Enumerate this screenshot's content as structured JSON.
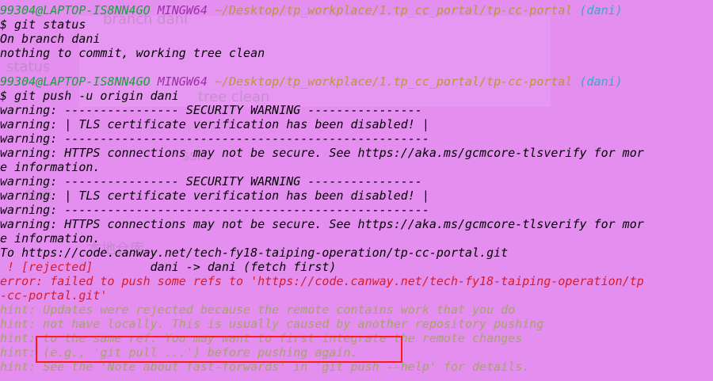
{
  "colors": {
    "background": "#e48ff0",
    "user_host": "#1b9e3b",
    "mingw": "#9b2fa8",
    "path": "#b89a2c",
    "branch": "#3aa7c9",
    "error": "#d71c28",
    "hint": "#a7a26a",
    "highlight_box": "#ff1a1a"
  },
  "ghost_text": [
    "branch  dani",
    "status",
    "tree clean",
    "ssh",
    "仓库",
    "本地仓库"
  ],
  "lines": [
    [
      {
        "t": "99304@LAPTOP-IS8NN4GO ",
        "c": "green"
      },
      {
        "t": "MINGW64 ",
        "c": "purple"
      },
      {
        "t": "~/Desktop/tp_workplace/1.tp_cc_portal/tp-cc-portal ",
        "c": "yellow"
      },
      {
        "t": "(dani)",
        "c": "cyan"
      }
    ],
    [
      {
        "t": "$ git status",
        "c": "black"
      }
    ],
    [
      {
        "t": "On branch dani",
        "c": "black"
      }
    ],
    [
      {
        "t": "nothing to commit, working tree clean",
        "c": "black"
      }
    ],
    [
      {
        "t": "",
        "c": "black"
      }
    ],
    [
      {
        "t": "99304@LAPTOP-IS8NN4GO ",
        "c": "green"
      },
      {
        "t": "MINGW64 ",
        "c": "purple"
      },
      {
        "t": "~/Desktop/tp_workplace/1.tp_cc_portal/tp-cc-portal ",
        "c": "yellow"
      },
      {
        "t": "(dani)",
        "c": "cyan"
      }
    ],
    [
      {
        "t": "$ git push -u origin dani",
        "c": "black"
      }
    ],
    [
      {
        "t": "warning: ---------------- SECURITY WARNING ----------------",
        "c": "black"
      }
    ],
    [
      {
        "t": "warning: | TLS certificate verification has been disabled! |",
        "c": "black"
      }
    ],
    [
      {
        "t": "warning: ---------------------------------------------------",
        "c": "black"
      }
    ],
    [
      {
        "t": "warning: HTTPS connections may not be secure. See https://aka.ms/gcmcore-tlsverify for mor",
        "c": "black"
      }
    ],
    [
      {
        "t": "e information.",
        "c": "black"
      }
    ],
    [
      {
        "t": "warning: ---------------- SECURITY WARNING ----------------",
        "c": "black"
      }
    ],
    [
      {
        "t": "warning: | TLS certificate verification has been disabled! |",
        "c": "black"
      }
    ],
    [
      {
        "t": "warning: ---------------------------------------------------",
        "c": "black"
      }
    ],
    [
      {
        "t": "warning: HTTPS connections may not be secure. See https://aka.ms/gcmcore-tlsverify for mor",
        "c": "black"
      }
    ],
    [
      {
        "t": "e information.",
        "c": "black"
      }
    ],
    [
      {
        "t": "To https://code.canway.net/tech-fy18-taiping-operation/tp-cc-portal.git",
        "c": "black"
      }
    ],
    [
      {
        "t": " ! [rejected]        ",
        "c": "red"
      },
      {
        "t": "dani -> dani (fetch first)",
        "c": "black"
      }
    ],
    [
      {
        "t": "error: failed to push some refs to 'https://code.canway.net/tech-fy18-taiping-operation/tp",
        "c": "red"
      }
    ],
    [
      {
        "t": "-cc-portal.git'",
        "c": "red"
      }
    ],
    [
      {
        "t": "hint: Updates were rejected because the remote contains work that you do",
        "c": "hint"
      }
    ],
    [
      {
        "t": "hint: not have locally. This is usually caused by another repository pushing",
        "c": "hint"
      }
    ],
    [
      {
        "t": "hint: to the same ref. You may want to first integrate the remote changes",
        "c": "hint"
      }
    ],
    [
      {
        "t": "hint: (e.g., 'git pull ...') before pushing again.",
        "c": "hint"
      }
    ],
    [
      {
        "t": "hint: See the 'Note about fast-forwards' in 'git push --help' for details.",
        "c": "hint"
      }
    ]
  ]
}
